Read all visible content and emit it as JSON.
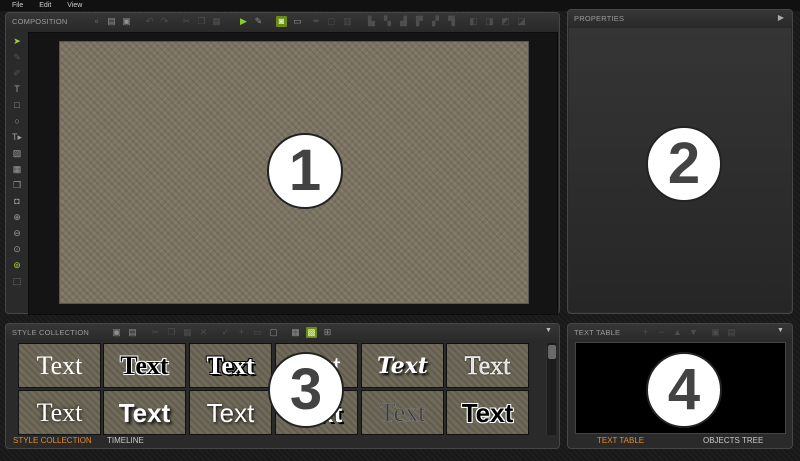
{
  "menu": {
    "items": [
      "File",
      "Edit",
      "View"
    ]
  },
  "composition": {
    "title": "COMPOSITION",
    "badge": "1",
    "toolbar_icons": [
      "new-file-icon",
      "open-folder-icon",
      "save-icon",
      "undo-icon",
      "redo-icon",
      "cut-icon",
      "copy-icon",
      "paste-icon",
      "play-icon",
      "edit-icon",
      "scene-settings-icon",
      "screen-icon",
      "pen-icon",
      "frame-icon",
      "frame-2-icon",
      "align-left-icon",
      "align-center-icon",
      "align-right-icon",
      "align-top-icon",
      "align-middle-icon",
      "align-bottom-icon",
      "arrange-front-icon",
      "arrange-back-icon",
      "group-icon",
      "ungroup-icon"
    ],
    "tools": [
      "select-arrow-icon",
      "pen-tool-icon",
      "node-tool-icon",
      "text-tool-icon",
      "rectangle-tool-icon",
      "ellipse-tool-icon",
      "text-path-tool-icon",
      "image-tool-icon",
      "film-tool-icon",
      "copy-tool-icon",
      "camera-tool-icon",
      "zoom-in-icon",
      "zoom-out-icon",
      "zoom-fit-icon",
      "zoom-actual-icon",
      "frame-select-icon"
    ]
  },
  "properties": {
    "title": "PROPERTIES",
    "badge": "2"
  },
  "style_collection": {
    "title": "STYLE COLLECTION",
    "badge": "3",
    "tiles": [
      {
        "text": "Text",
        "style": "serif-white"
      },
      {
        "text": "Text",
        "style": "black-bold-white-outline"
      },
      {
        "text": "Text",
        "style": "white-bold-black-outline"
      },
      {
        "text": "Text",
        "style": "plain"
      },
      {
        "text": "Text",
        "style": "italic-script"
      },
      {
        "text": "Text",
        "style": "serif-outline"
      },
      {
        "text": "Text",
        "style": "serif-white-glow"
      },
      {
        "text": "Text",
        "style": "bold-white-shadow"
      },
      {
        "text": "Text",
        "style": "sans-white-shadow"
      },
      {
        "text": "Text",
        "style": "bold-white-black-outline"
      },
      {
        "text": "Text",
        "style": "dark-outline"
      },
      {
        "text": "Text",
        "style": "black-bold-white-stroke"
      }
    ],
    "tabs": {
      "active": "STYLE COLLECTION",
      "inactive": "TIMELINE"
    },
    "dropdown_icon": "chevron-down-icon"
  },
  "text_table": {
    "title": "TEXT TABLE",
    "badge": "4",
    "tabs": {
      "active": "TEXT TABLE",
      "inactive": "OBJECTS TREE"
    },
    "dropdown_icon": "chevron-down-icon"
  },
  "colors": {
    "accent_orange": "#e5892d",
    "accent_green": "#8ccb2a",
    "canvas": "#7d7563",
    "panel": "#2a2a2a"
  }
}
